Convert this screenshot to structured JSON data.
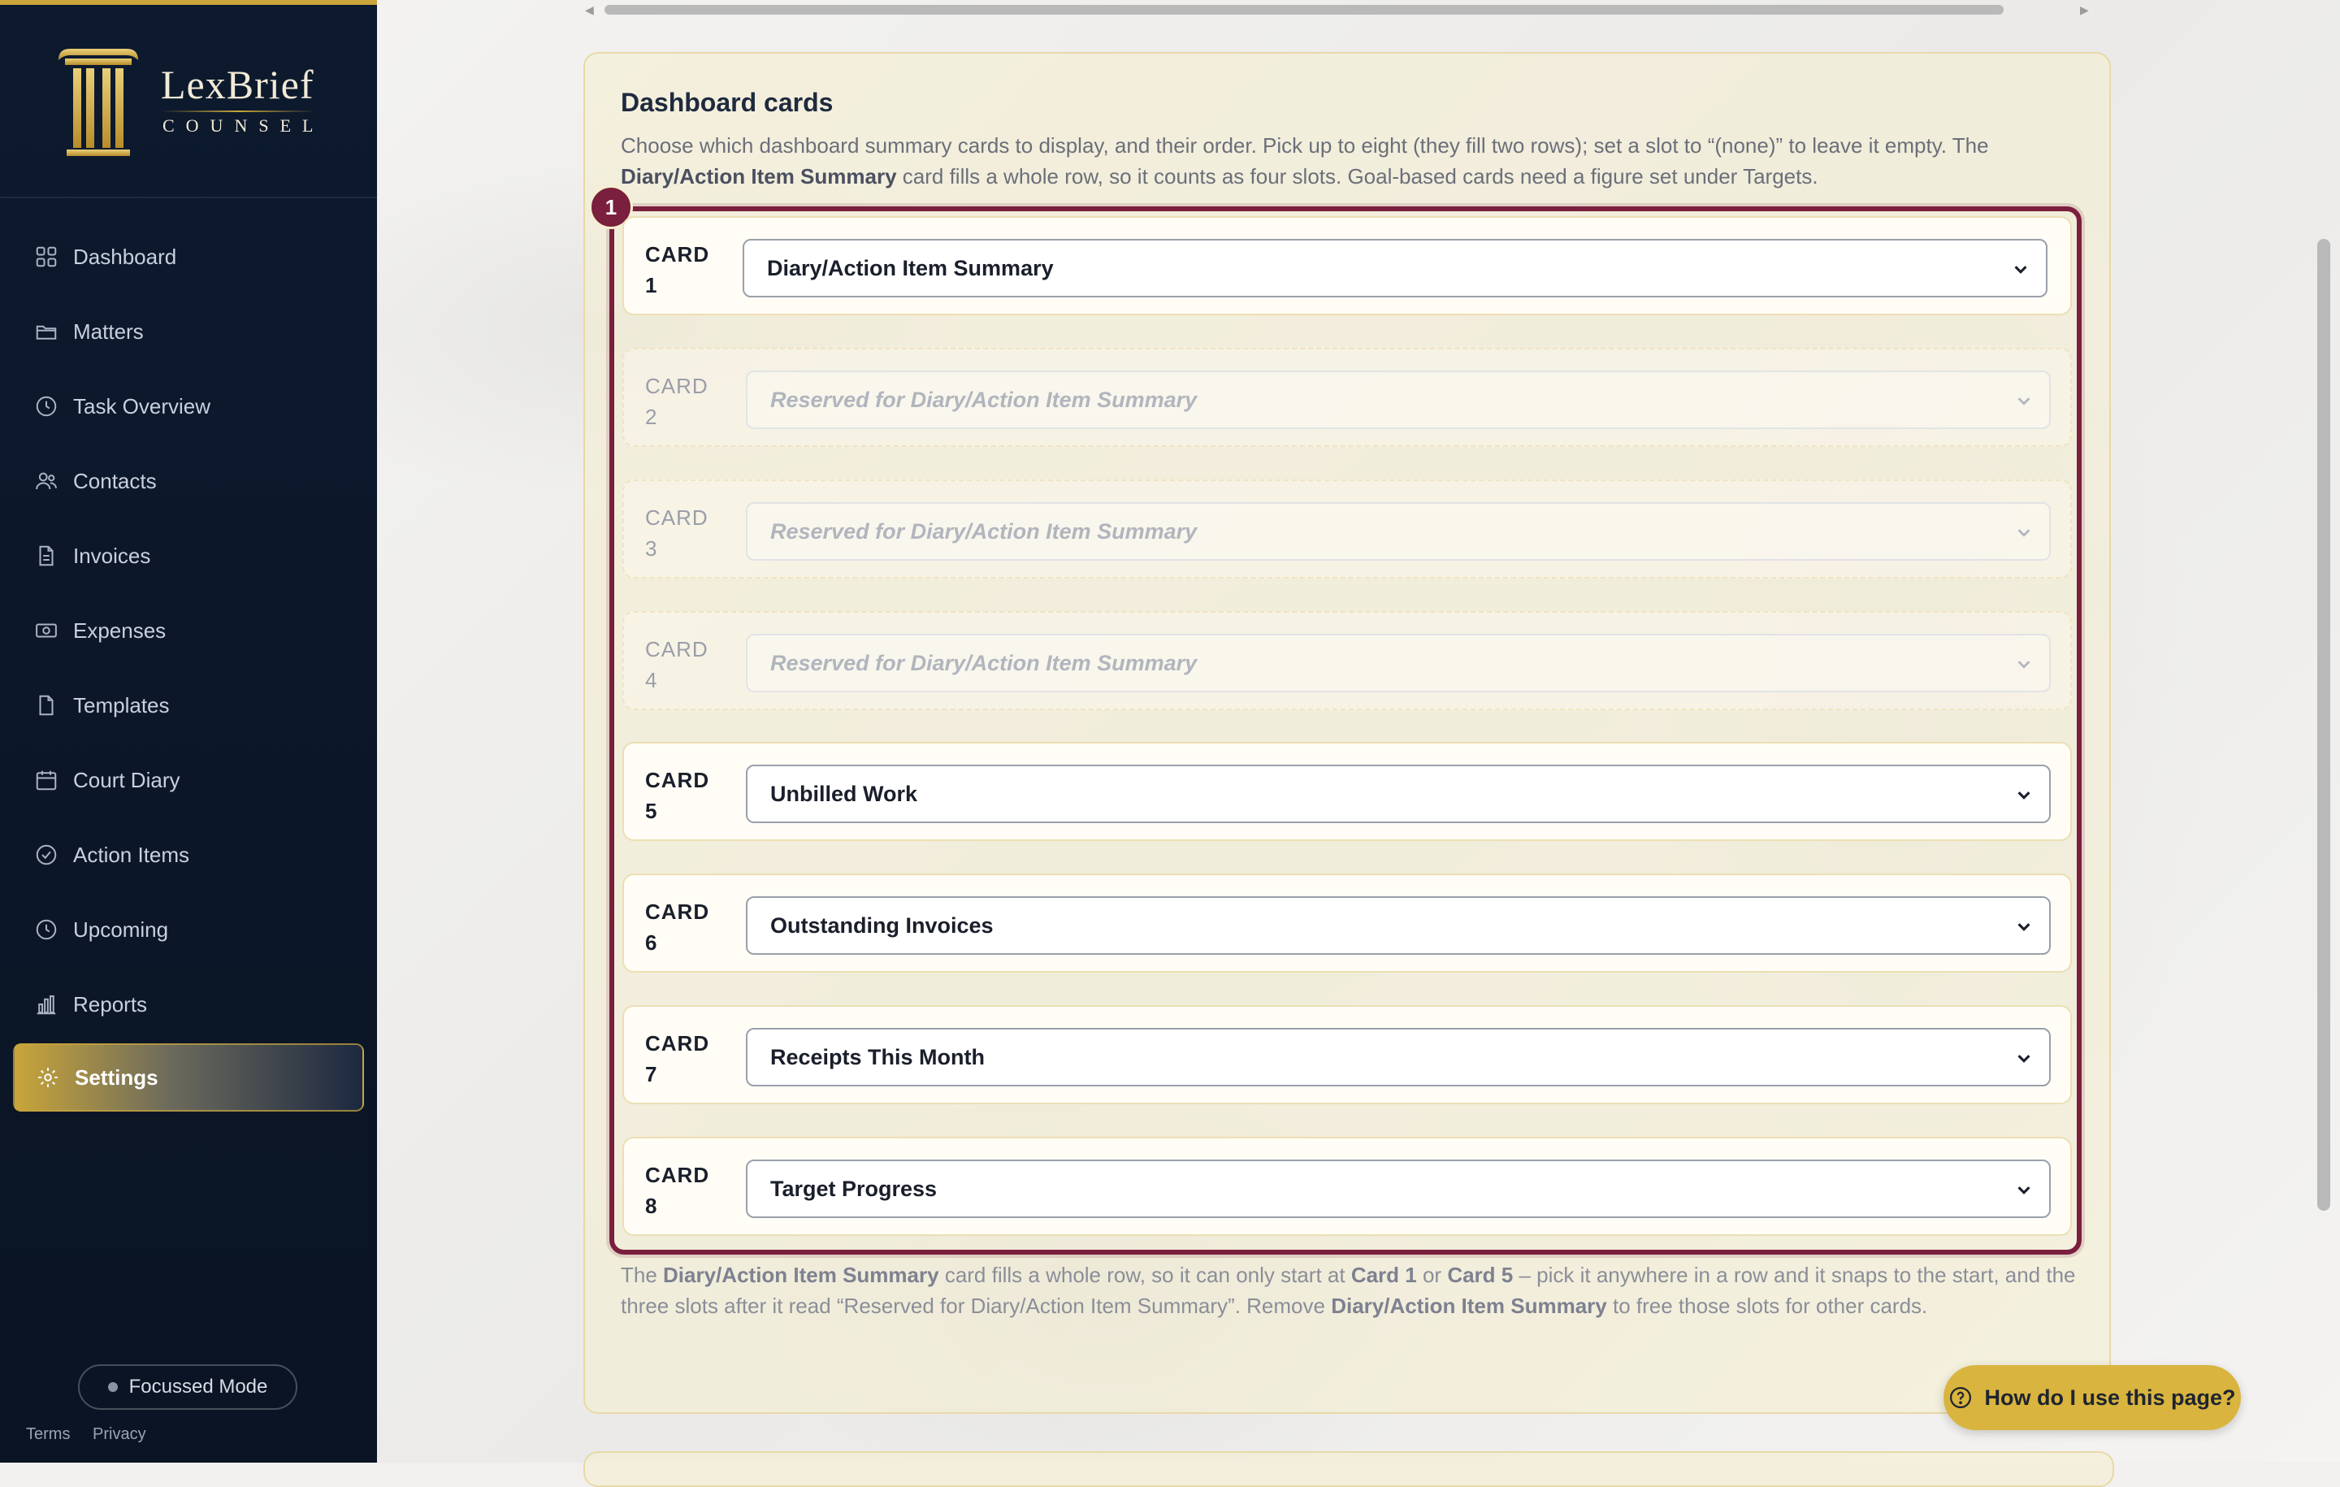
{
  "brand": {
    "name": "LexBrief",
    "tagline": "COUNSEL"
  },
  "sidebar": {
    "items": [
      {
        "label": "Dashboard",
        "icon": "grid-icon"
      },
      {
        "label": "Matters",
        "icon": "folder-icon"
      },
      {
        "label": "Task Overview",
        "icon": "clock-icon"
      },
      {
        "label": "Contacts",
        "icon": "users-icon"
      },
      {
        "label": "Invoices",
        "icon": "document-icon"
      },
      {
        "label": "Expenses",
        "icon": "money-icon"
      },
      {
        "label": "Templates",
        "icon": "file-icon"
      },
      {
        "label": "Court Diary",
        "icon": "calendar-icon"
      },
      {
        "label": "Action Items",
        "icon": "check-circle-icon"
      },
      {
        "label": "Upcoming",
        "icon": "clock-icon"
      },
      {
        "label": "Reports",
        "icon": "bar-chart-icon"
      },
      {
        "label": "Settings",
        "icon": "gear-icon",
        "active": true
      }
    ],
    "focus_mode_label": "Focussed Mode",
    "footer_links": [
      "Terms",
      "Privacy"
    ]
  },
  "panel": {
    "title": "Dashboard cards",
    "description_prefix": "Choose which dashboard summary cards to display, and their order. Pick up to eight (they fill two rows); set a slot to “(none)” to leave it empty. The ",
    "description_bold": "Diary/Action Item Summary",
    "description_suffix": " card fills a whole row, so it counts as four slots. Goal-based cards need a figure set under Targets.",
    "badge": "1",
    "slots": [
      {
        "label": "CARD 1",
        "value": "Diary/Action Item Summary",
        "reserved": false
      },
      {
        "label": "CARD 2",
        "value": "Reserved for Diary/Action Item Summary",
        "reserved": true
      },
      {
        "label": "CARD 3",
        "value": "Reserved for Diary/Action Item Summary",
        "reserved": true
      },
      {
        "label": "CARD 4",
        "value": "Reserved for Diary/Action Item Summary",
        "reserved": true
      },
      {
        "label": "CARD 5",
        "value": "Unbilled Work",
        "reserved": false
      },
      {
        "label": "CARD 6",
        "value": "Outstanding Invoices",
        "reserved": false
      },
      {
        "label": "CARD 7",
        "value": "Receipts This Month",
        "reserved": false
      },
      {
        "label": "CARD 8",
        "value": "Target Progress",
        "reserved": false
      }
    ],
    "footnote": {
      "p1": "The ",
      "b1": "Diary/Action Item Summary",
      "p2": " card fills a whole row, so it can only start at ",
      "b2": "Card 1",
      "p3": " or ",
      "b3": "Card 5",
      "p4": " – pick it anywhere in a row and it snaps to the start, and the three slots after it read “Reserved for Diary/Action Item Summary”. Remove ",
      "b4": "Diary/Action Item Summary",
      "p5": " to free those slots for other cards."
    }
  },
  "help_button_label": "How do I use this page?",
  "colors": {
    "accent_gold": "#c9a53a",
    "highlight_maroon": "#7a1f3d",
    "sidebar_bg": "#0d1a2e"
  }
}
